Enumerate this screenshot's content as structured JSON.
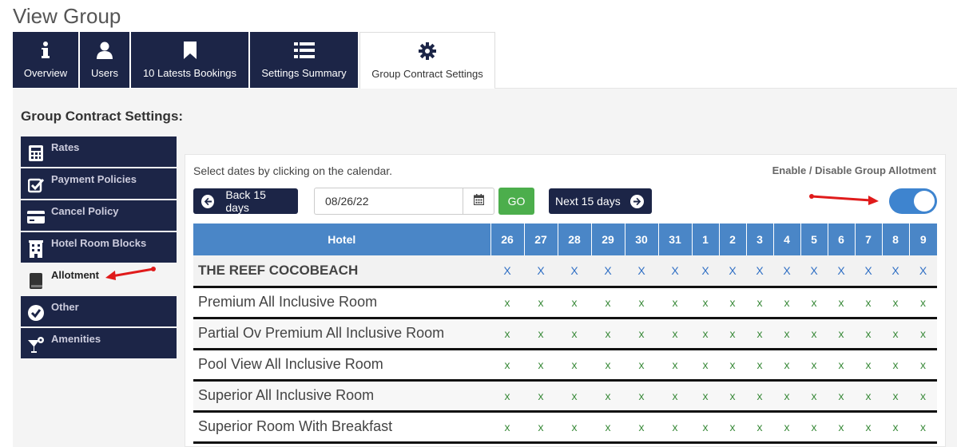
{
  "page_title": "View Group",
  "tabs": [
    {
      "label": "Overview",
      "icon": "info-icon"
    },
    {
      "label": "Users",
      "icon": "user-icon"
    },
    {
      "label": "10 Latests Bookings",
      "icon": "bookmark-icon"
    },
    {
      "label": "Settings Summary",
      "icon": "list-icon"
    },
    {
      "label": "Group Contract Settings",
      "icon": "gear-icon",
      "active": true
    }
  ],
  "section_title": "Group Contract Settings:",
  "sidebar": {
    "items": [
      {
        "label": "Rates",
        "icon": "calculator-icon"
      },
      {
        "label": "Payment Policies",
        "icon": "checkbox-icon"
      },
      {
        "label": "Cancel Policy",
        "icon": "card-icon"
      },
      {
        "label": "Hotel Room Blocks",
        "icon": "building-icon"
      },
      {
        "label": "Allotment",
        "icon": "book-icon",
        "active": true
      },
      {
        "label": "Other",
        "icon": "check-circle-icon"
      },
      {
        "label": "Amenities",
        "icon": "cocktail-icon"
      }
    ]
  },
  "allotment": {
    "hint": "Select dates by clicking on the calendar.",
    "toggle_label": "Enable / Disable Group Allotment",
    "toggle_on": true,
    "back_label": "Back 15 days",
    "next_label": "Next 15 days",
    "date_value": "08/26/22",
    "go_label": "GO",
    "hotel_header": "Hotel",
    "days": [
      "26",
      "27",
      "28",
      "29",
      "30",
      "31",
      "1",
      "2",
      "3",
      "4",
      "5",
      "6",
      "7",
      "8",
      "9"
    ],
    "hotel_name": "THE REEF COCOBEACH",
    "cell_mark": "X",
    "room_mark": "x",
    "rooms": [
      "Premium All Inclusive Room",
      "Partial Ov Premium All Inclusive Room",
      "Pool View All Inclusive Room",
      "Superior All Inclusive Room",
      "Superior Room With Breakfast"
    ]
  },
  "colors": {
    "navy": "#1c2547",
    "header_blue": "#4a86c7",
    "go_green": "#4cae4c",
    "toggle_blue": "#3e84cf",
    "arrow_red": "#e01b1b"
  }
}
